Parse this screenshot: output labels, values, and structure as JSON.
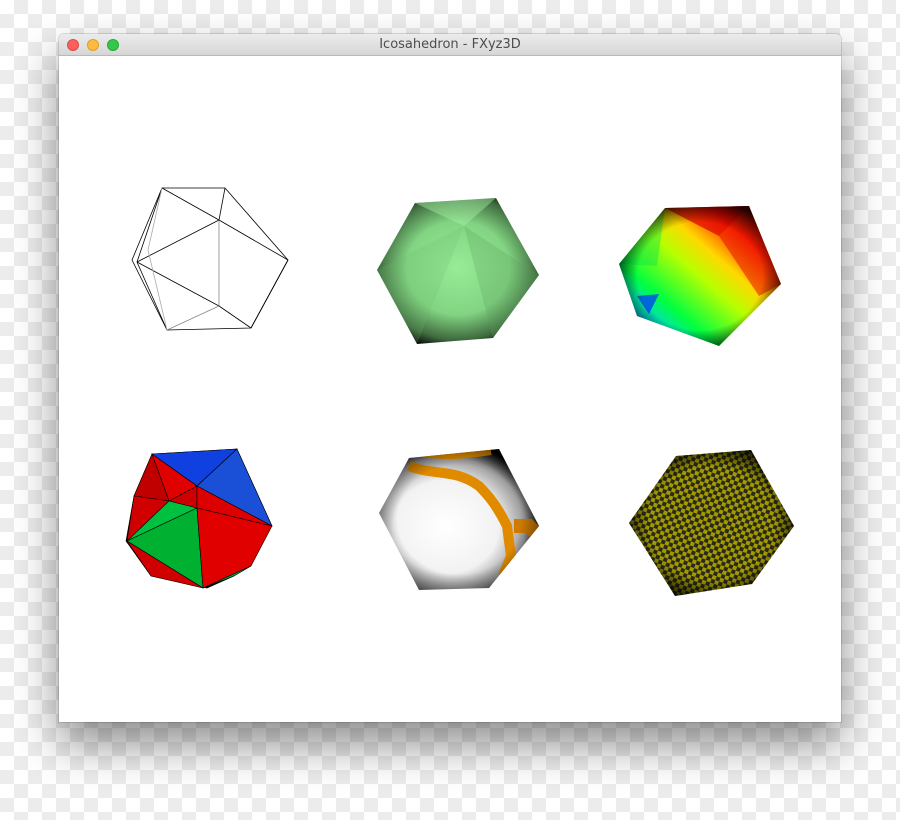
{
  "window": {
    "title": "Icosahedron - FXyz3D",
    "controls": [
      "close",
      "minimize",
      "zoom"
    ]
  },
  "scene": {
    "objects": [
      {
        "name": "wireframe-icosahedron",
        "material": "wireframe",
        "color": "#000000"
      },
      {
        "name": "solid-green-icosahedron",
        "material": "solid",
        "color": "#8fe08f"
      },
      {
        "name": "color-gradient-icosahedron",
        "material": "vertex-gradient",
        "colors": [
          "#ff0000",
          "#ffff00",
          "#00ff00",
          "#0000ff"
        ]
      },
      {
        "name": "faces-colored-icosahedron",
        "material": "face-colors",
        "colors": [
          "#ff0000",
          "#0000ff",
          "#00ff00"
        ]
      },
      {
        "name": "image-textured-icosahedron",
        "material": "image-texture",
        "colors": [
          "#ffffff",
          "#ff9900"
        ]
      },
      {
        "name": "pattern-textured-icosahedron",
        "material": "checker-pattern",
        "colors": [
          "#9c9400",
          "#1e1e1e"
        ]
      }
    ]
  }
}
